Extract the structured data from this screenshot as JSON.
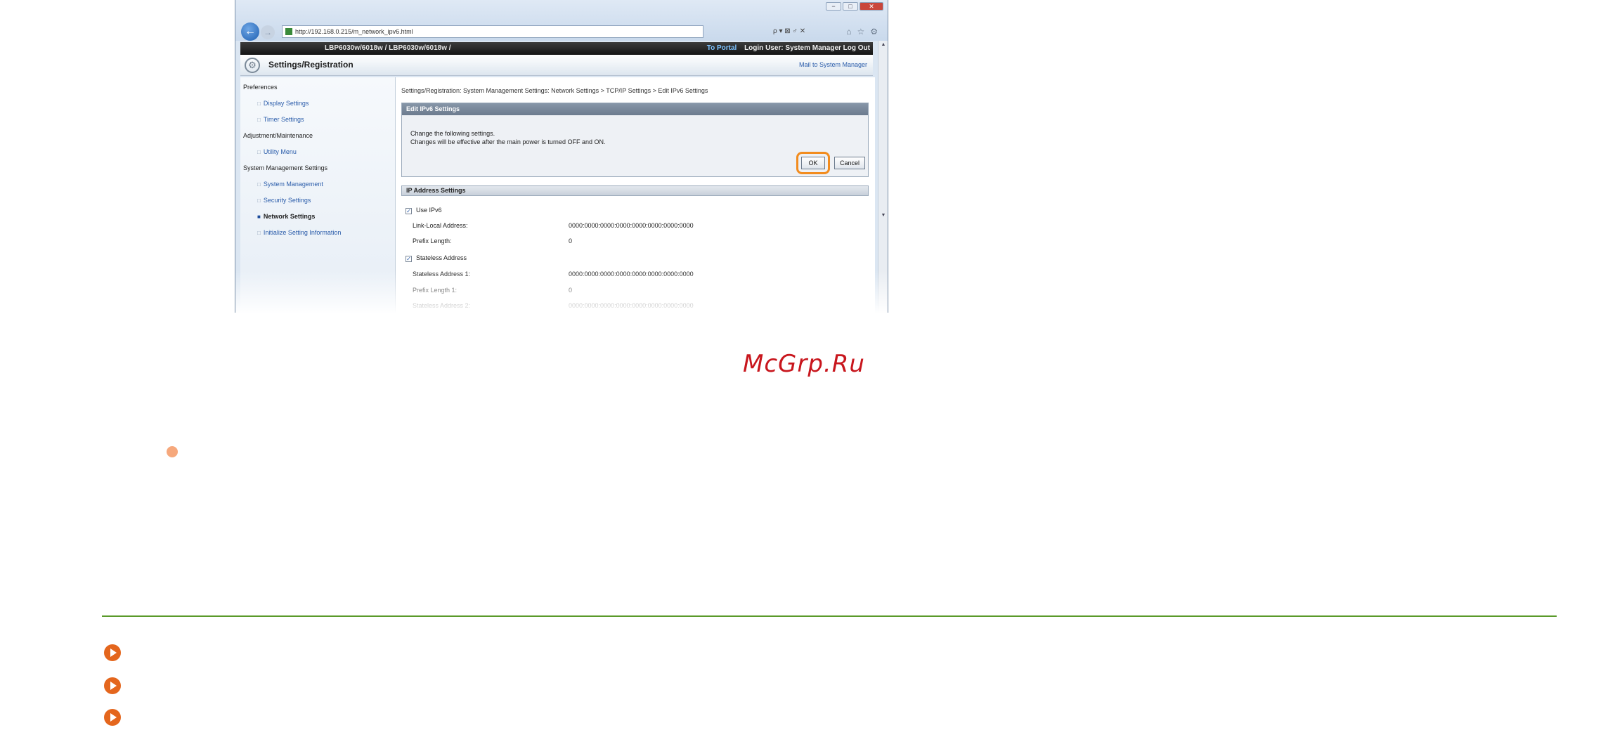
{
  "browser": {
    "url": "http://192.168.0.215/m_network_ipv6.html",
    "addr_tools": "ρ ▾ ⊠ ♂ ✕",
    "win_min": "−",
    "win_max": "□",
    "win_close": "✕"
  },
  "app": {
    "device": "LBP6030w/6018w / LBP6030w/6018w /",
    "to_portal": "To Portal",
    "login_user": "Login User: System Manager Log Out",
    "title": "Settings/Registration",
    "mail_link": "Mail to System Manager"
  },
  "sidebar": {
    "sections": [
      {
        "label": "Preferences",
        "items": [
          "Display Settings",
          "Timer Settings"
        ]
      },
      {
        "label": "Adjustment/Maintenance",
        "items": [
          "Utility Menu"
        ]
      },
      {
        "label": "System Management Settings",
        "items": [
          "System Management",
          "Security Settings",
          "Network Settings",
          "Initialize Setting Information"
        ]
      }
    ],
    "active_item": "Network Settings"
  },
  "main": {
    "breadcrumb": "Settings/Registration: System Management Settings: Network Settings > TCP/IP Settings > Edit IPv6 Settings",
    "panel_title": "Edit IPv6 Settings",
    "message_line1": "Change the following settings.",
    "message_line2": "Changes will be effective after the main power is turned OFF and ON.",
    "ok_label": "OK",
    "cancel_label": "Cancel",
    "ip_header": "IP Address Settings",
    "use_ipv6_label": "Use IPv6",
    "link_local_label": "Link-Local Address:",
    "link_local_value": "0000:0000:0000:0000:0000:0000:0000:0000",
    "prefix_length_label": "Prefix Length:",
    "prefix_length_value": "0",
    "stateless_label": "Stateless Address",
    "stateless1_label": "Stateless Address 1:",
    "stateless1_value": "0000:0000:0000:0000:0000:0000:0000:0000",
    "prefix1_label": "Prefix Length 1:",
    "prefix1_value": "0",
    "stateless2_label": "Stateless Address 2:",
    "stateless2_value": "0000:0000:0000:0000:0000:0000:0000:0000"
  },
  "watermark": "McGrp.Ru",
  "colors": {
    "ok_highlight": "#f28c1e",
    "divider": "#5a9a2a",
    "link_icon": "#e4661d",
    "watermark": "#c8161d",
    "bullet": "#f6a87c"
  }
}
